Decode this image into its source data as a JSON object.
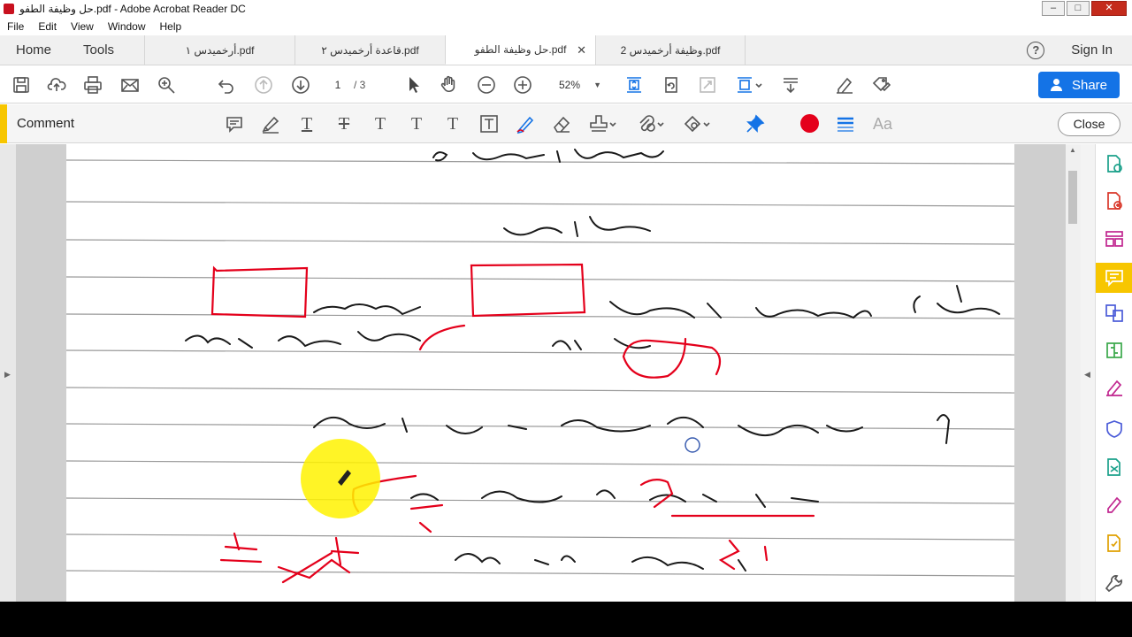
{
  "window": {
    "title": "حل وظيفة الطفو.pdf - Adobe Acrobat Reader DC",
    "buttons": {
      "minimize": "–",
      "maximize": "□",
      "close": "✕"
    }
  },
  "menu": [
    "File",
    "Edit",
    "View",
    "Window",
    "Help"
  ],
  "nav": {
    "home": "Home",
    "tools": "Tools"
  },
  "tabs": [
    {
      "label": "أرخميدس ١.pdf",
      "active": false
    },
    {
      "label": "قاعدة أرخميدس ٢.pdf",
      "active": false
    },
    {
      "label": "حل وظيفة الطفو.pdf",
      "active": true,
      "close": "✕"
    },
    {
      "label": "وظيفة أرخميدس 2.pdf",
      "active": false
    }
  ],
  "header_right": {
    "help": "?",
    "sign_in": "Sign In"
  },
  "toolbar": {
    "page_current": "1",
    "page_total": "/ 3",
    "zoom": "52%",
    "share_label": "Share",
    "icons": [
      "save-icon",
      "upload-icon",
      "print-icon",
      "email-icon",
      "search-icon",
      "undo-icon",
      "previous-page-icon",
      "next-page-icon",
      "select-arrow-icon",
      "hand-icon",
      "zoom-out-icon",
      "zoom-in-icon",
      "fit-page-icon",
      "rotate-icon",
      "full-screen-icon",
      "scroll-mode-icon",
      "read-mode-icon",
      "sign-icon",
      "fill-sign-icon"
    ]
  },
  "comment_bar": {
    "label": "Comment",
    "close_label": "Close",
    "font_label": "Aa",
    "active_color": "#e4001b",
    "icons": [
      "sticky-note-icon",
      "highlighter-icon",
      "underline-text-icon",
      "strikethrough-text-icon",
      "replace-text-icon",
      "insert-text-icon",
      "add-text-comment-icon",
      "text-box-icon",
      "pencil-draw-icon",
      "eraser-icon",
      "stamp-icon",
      "attach-icon",
      "shapes-icon",
      "pin-icon",
      "color-dot",
      "line-thickness-icon",
      "font-icon"
    ]
  },
  "right_panel_icons": [
    "export-pdf-icon",
    "create-pdf-icon",
    "organize-pages-icon",
    "comment-icon",
    "combine-files-icon",
    "compress-pdf-icon",
    "fill-sign-icon",
    "protect-icon",
    "send-track-icon",
    "edit-pdf-icon",
    "send-for-review-icon",
    "more-tools-icon"
  ],
  "colors": {
    "accent_yellow": "#f7c600",
    "brand_blue": "#1473e6",
    "ink_red": "#e4001b"
  }
}
